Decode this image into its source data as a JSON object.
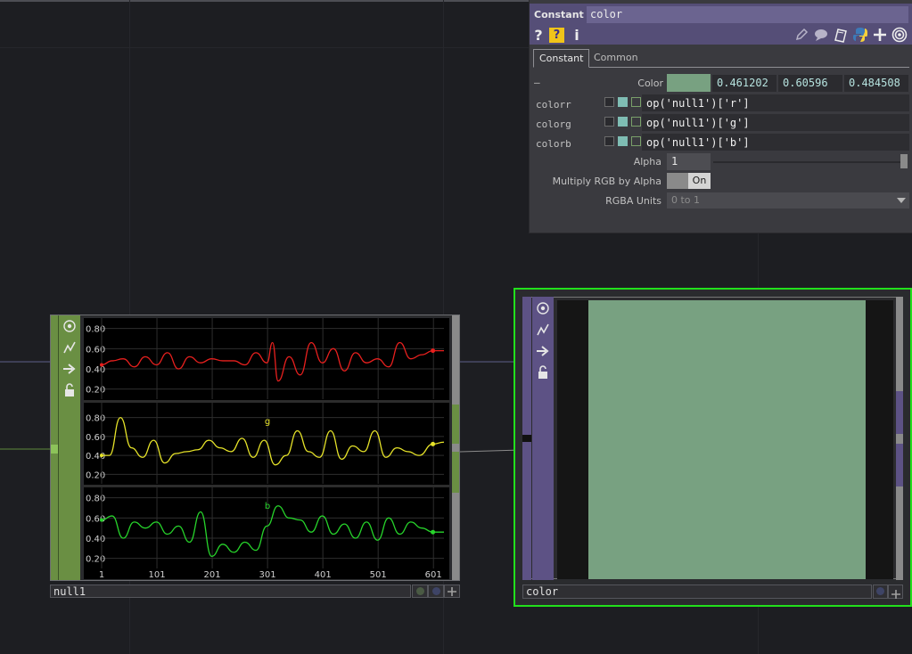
{
  "colors": {
    "background": "#1d1e22",
    "constant_header": "#554e77",
    "constant_node": "#5d5285",
    "chop_node": "#6a8f43",
    "swatch": "#78a181",
    "selected_border": "#22e01c",
    "channel_r": "#e8201e",
    "channel_g": "#e6e329",
    "channel_b": "#27d42b"
  },
  "panel": {
    "op_type": "Constant",
    "op_name": "color",
    "icons": [
      "help-icon",
      "help-python-icon",
      "info-icon",
      "edit-icon",
      "comment-icon",
      "clone-icon",
      "python-icon",
      "add-icon",
      "viewer-icon"
    ],
    "help_label": "?",
    "info_label": "i",
    "tabs": [
      {
        "label": "Constant",
        "active": true
      },
      {
        "label": "Common",
        "active": false
      }
    ],
    "collapse_label": "—",
    "color_label": "Color",
    "color_values": [
      "0.461202",
      "0.60596",
      "0.484508"
    ],
    "rows": [
      {
        "name": "colorr",
        "expr": "op('null1')['r']"
      },
      {
        "name": "colorg",
        "expr": "op('null1')['g']"
      },
      {
        "name": "colorb",
        "expr": "op('null1')['b']"
      }
    ],
    "alpha_label": "Alpha",
    "alpha_value": "1",
    "multiply_label": "Multiply RGB by Alpha",
    "multiply_value": "On",
    "units_label": "RGBA Units",
    "units_value": "0 to 1"
  },
  "null_node": {
    "name": "null1"
  },
  "constant_node": {
    "name": "color"
  },
  "chart_data": {
    "type": "line",
    "x_ticks": [
      "1",
      "101",
      "201",
      "301",
      "401",
      "501",
      "601"
    ],
    "x_range": [
      1,
      620
    ],
    "panels": [
      {
        "channel": "r",
        "y_ticks": [
          "0.80",
          "0.60",
          "0.40",
          "0.20"
        ],
        "ylim": [
          0.1,
          0.85
        ],
        "color": "#e8201e",
        "label": "",
        "x": [
          1,
          20,
          40,
          60,
          80,
          100,
          120,
          140,
          160,
          180,
          200,
          220,
          240,
          260,
          280,
          300,
          310,
          320,
          340,
          360,
          380,
          400,
          420,
          440,
          460,
          480,
          500,
          520,
          540,
          560,
          580,
          600,
          620
        ],
        "y": [
          0.44,
          0.48,
          0.5,
          0.42,
          0.52,
          0.44,
          0.56,
          0.4,
          0.52,
          0.46,
          0.5,
          0.48,
          0.48,
          0.44,
          0.56,
          0.46,
          0.66,
          0.28,
          0.52,
          0.34,
          0.66,
          0.46,
          0.6,
          0.38,
          0.56,
          0.46,
          0.5,
          0.42,
          0.66,
          0.5,
          0.54,
          0.58,
          0.58
        ]
      },
      {
        "channel": "g",
        "y_ticks": [
          "0.80",
          "0.60",
          "0.40",
          "0.20"
        ],
        "ylim": [
          0.1,
          0.9
        ],
        "color": "#e6e329",
        "label": "g",
        "x": [
          1,
          15,
          35,
          55,
          75,
          95,
          115,
          135,
          155,
          175,
          195,
          215,
          235,
          255,
          275,
          295,
          315,
          335,
          355,
          375,
          395,
          415,
          435,
          455,
          475,
          495,
          515,
          535,
          555,
          575,
          600,
          620
        ],
        "y": [
          0.4,
          0.4,
          0.8,
          0.48,
          0.38,
          0.56,
          0.32,
          0.42,
          0.44,
          0.46,
          0.56,
          0.48,
          0.44,
          0.58,
          0.38,
          0.56,
          0.3,
          0.4,
          0.66,
          0.44,
          0.38,
          0.66,
          0.36,
          0.5,
          0.44,
          0.66,
          0.38,
          0.48,
          0.44,
          0.4,
          0.52,
          0.54
        ]
      },
      {
        "channel": "b",
        "y_ticks": [
          "0.80",
          "0.60",
          "0.40",
          "0.20"
        ],
        "ylim": [
          0.1,
          0.85
        ],
        "color": "#27d42b",
        "label": "b",
        "x": [
          1,
          20,
          40,
          60,
          80,
          100,
          120,
          140,
          160,
          180,
          200,
          220,
          240,
          260,
          280,
          300,
          320,
          340,
          360,
          380,
          400,
          420,
          440,
          460,
          480,
          500,
          520,
          540,
          560,
          580,
          600,
          620
        ],
        "y": [
          0.58,
          0.62,
          0.4,
          0.56,
          0.5,
          0.56,
          0.44,
          0.52,
          0.36,
          0.66,
          0.22,
          0.34,
          0.26,
          0.36,
          0.28,
          0.52,
          0.72,
          0.6,
          0.58,
          0.46,
          0.62,
          0.44,
          0.54,
          0.4,
          0.56,
          0.38,
          0.6,
          0.44,
          0.56,
          0.5,
          0.46,
          0.46
        ]
      }
    ]
  }
}
